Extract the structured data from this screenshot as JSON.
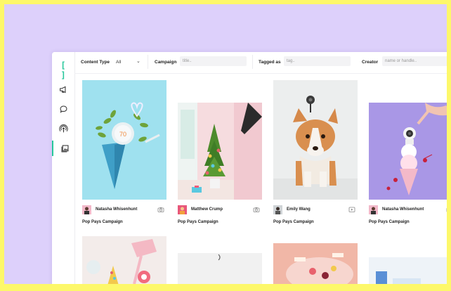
{
  "filters": {
    "content_type_label": "Content Type",
    "content_type_value": "All",
    "campaign_label": "Campaign",
    "campaign_placeholder": "title..",
    "tagged_label": "Tagged as",
    "tagged_placeholder": "tag..",
    "creator_label": "Creator",
    "creator_placeholder": "name or handle.."
  },
  "sidebar": {
    "logo": "[ ]",
    "items": [
      {
        "icon": "megaphone-icon"
      },
      {
        "icon": "chat-bubble-icon"
      },
      {
        "icon": "podcast-icon"
      },
      {
        "icon": "gallery-icon",
        "active": true
      }
    ]
  },
  "cards": [
    {
      "creator": "Natasha Whisenhunt",
      "campaign": "Pop Pays Campaign",
      "type_icon": "camera-icon"
    },
    {
      "creator": "Matthew Crump",
      "campaign": "Pop Pays Campaign",
      "type_icon": "camera-icon"
    },
    {
      "creator": "Emily Wang",
      "campaign": "Pop Pays Campaign",
      "type_icon": "video-icon"
    },
    {
      "creator": "Natasha Whisenhunt",
      "campaign": "Pop Pays Campaign",
      "type_icon": "camera-icon"
    }
  ],
  "thermostat_reading": "70",
  "colors": {
    "accent": "#27c79b",
    "background_lavender": "#ddd0fb",
    "border_yellow": "#fdf86a"
  }
}
